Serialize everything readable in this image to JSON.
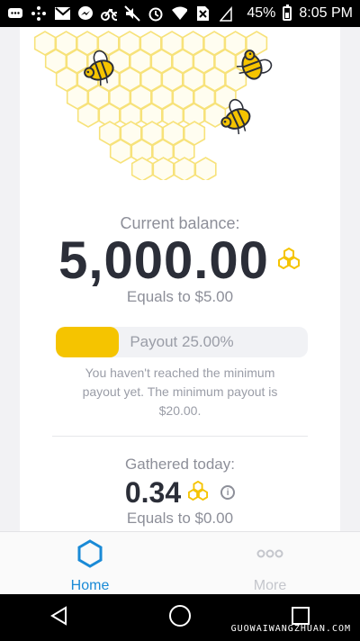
{
  "status_bar": {
    "battery_percent": "45%",
    "time": "8:05 PM",
    "icons": [
      "chat-icon",
      "dots-icon",
      "gmail-icon",
      "messenger-icon",
      "bike-icon",
      "mute-icon",
      "alarm-icon",
      "wifi-icon",
      "no-sim-icon",
      "signal-icon",
      "battery-icon"
    ]
  },
  "balance": {
    "label": "Current balance:",
    "value": "5,000.00",
    "equals": "Equals to $5.00"
  },
  "payout": {
    "progress_fraction": 0.25,
    "label": "Payout 25.00%",
    "note": "You haven't reached the minimum payout yet. The minimum payout is $20.00."
  },
  "gathered": {
    "label": "Gathered today:",
    "value": "0.34",
    "equals": "Equals to $0.00"
  },
  "nav": {
    "home_label": "Home",
    "more_label": "More"
  },
  "watermark": "GUOWAIWANGZHUAN.COM",
  "colors": {
    "accent": "#1a8ad6",
    "honey": "#f5c400",
    "text_dark": "#2b2e38",
    "text_muted": "#8d8f99"
  }
}
